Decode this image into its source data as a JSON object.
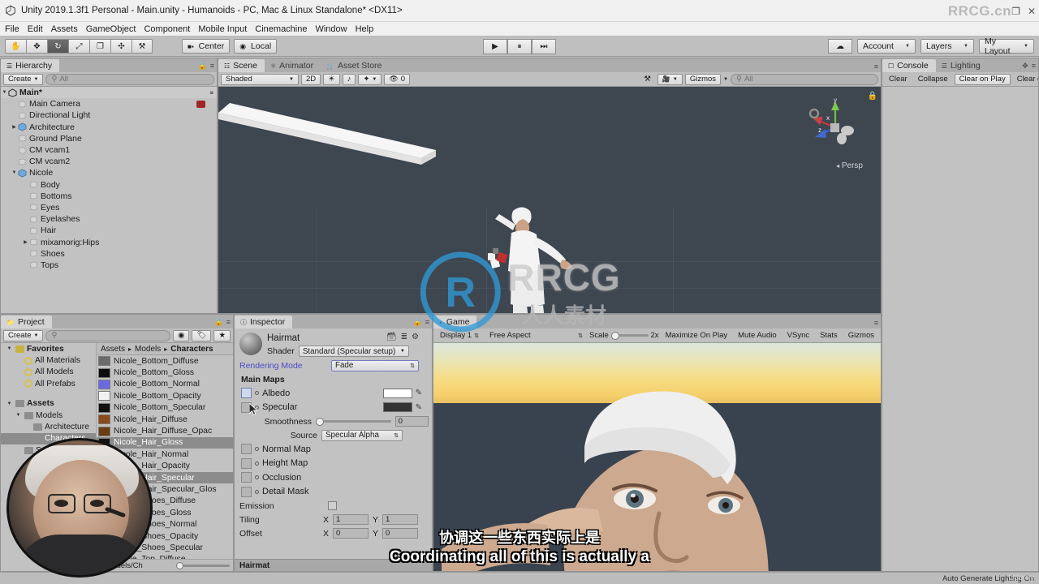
{
  "window": {
    "title": "Unity 2019.1.3f1 Personal - Main.unity - Humanoids - PC, Mac & Linux Standalone* <DX11>",
    "minimize": "–",
    "maximize": "❐",
    "close": "✕",
    "watermark": "RRCG.cn"
  },
  "menu": {
    "items": [
      "File",
      "Edit",
      "Assets",
      "GameObject",
      "Component",
      "Mobile Input",
      "Cinemachine",
      "Window",
      "Help"
    ]
  },
  "toolbar": {
    "tools": [
      {
        "name": "hand-tool",
        "glyph": "✋",
        "selected": false
      },
      {
        "name": "move-tool",
        "glyph": "✥",
        "selected": false
      },
      {
        "name": "rotate-tool",
        "glyph": "↻",
        "selected": true
      },
      {
        "name": "scale-tool",
        "glyph": "⤢",
        "selected": false
      },
      {
        "name": "rect-tool",
        "glyph": "❐",
        "selected": false
      },
      {
        "name": "transform-tool",
        "glyph": "✣",
        "selected": false
      },
      {
        "name": "custom-tool",
        "glyph": "⚒",
        "selected": false
      }
    ],
    "pivot_mode": "Center",
    "pivot_rotation": "Local",
    "play": "▶",
    "pause": "⏸",
    "step": "⏭",
    "cloud": "☁",
    "account": "Account",
    "layers": "Layers",
    "layout": "My Layout"
  },
  "hierarchy": {
    "tab": "Hierarchy",
    "create": "Create",
    "search_placeholder": "All",
    "scene_name": "Main*",
    "items": [
      {
        "label": "Main Camera",
        "depth": 1,
        "expandable": false,
        "prefab": false,
        "camera_badge": true
      },
      {
        "label": "Directional Light",
        "depth": 1,
        "expandable": false,
        "prefab": false
      },
      {
        "label": "Architecture",
        "depth": 1,
        "expandable": true,
        "expanded": false,
        "prefab": true
      },
      {
        "label": "Ground Plane",
        "depth": 1,
        "expandable": false,
        "prefab": false
      },
      {
        "label": "CM vcam1",
        "depth": 1,
        "expandable": false,
        "prefab": false
      },
      {
        "label": "CM vcam2",
        "depth": 1,
        "expandable": false,
        "prefab": false
      },
      {
        "label": "Nicole",
        "depth": 1,
        "expandable": true,
        "expanded": true,
        "prefab": true
      },
      {
        "label": "Body",
        "depth": 2,
        "expandable": false,
        "prefab": false
      },
      {
        "label": "Bottoms",
        "depth": 2,
        "expandable": false,
        "prefab": false
      },
      {
        "label": "Eyes",
        "depth": 2,
        "expandable": false,
        "prefab": false
      },
      {
        "label": "Eyelashes",
        "depth": 2,
        "expandable": false,
        "prefab": false
      },
      {
        "label": "Hair",
        "depth": 2,
        "expandable": false,
        "prefab": false
      },
      {
        "label": "mixamorig:Hips",
        "depth": 2,
        "expandable": true,
        "expanded": false,
        "prefab": false
      },
      {
        "label": "Shoes",
        "depth": 2,
        "expandable": false,
        "prefab": false
      },
      {
        "label": "Tops",
        "depth": 2,
        "expandable": false,
        "prefab": false
      }
    ]
  },
  "scene": {
    "tabs": [
      {
        "label": "Scene",
        "icon": "grid-icon",
        "selected": true
      },
      {
        "label": "Animator",
        "icon": "animator-icon",
        "selected": false
      },
      {
        "label": "Asset Store",
        "icon": "store-icon",
        "selected": false
      }
    ],
    "draw_mode": "Shaded",
    "mode_2d": "2D",
    "lighting_icon": "☀",
    "audio_icon": "♪",
    "fx_icon": "✦",
    "hidden_count": "0",
    "gizmos": "Gizmos",
    "search_placeholder": "All",
    "perspective_label": "Persp",
    "axis_x": "x",
    "axis_y": "y",
    "axis_z": "z"
  },
  "project": {
    "tab": "Project",
    "create": "Create",
    "search_placeholder": "",
    "breadcrumb": [
      "Assets",
      "Models",
      "Characters"
    ],
    "tree": [
      {
        "label": "Favorites",
        "depth": 0,
        "kind": "folder-yellow",
        "expanded": true,
        "bold": true
      },
      {
        "label": "All Materials",
        "depth": 1,
        "kind": "favorite"
      },
      {
        "label": "All Models",
        "depth": 1,
        "kind": "favorite"
      },
      {
        "label": "All Prefabs",
        "depth": 1,
        "kind": "favorite"
      },
      {
        "label": "",
        "depth": 0,
        "kind": "spacer"
      },
      {
        "label": "Assets",
        "depth": 0,
        "kind": "folder",
        "expanded": true,
        "bold": true
      },
      {
        "label": "Models",
        "depth": 1,
        "kind": "folder",
        "expanded": true
      },
      {
        "label": "Architecture",
        "depth": 2,
        "kind": "folder"
      },
      {
        "label": "Characters",
        "depth": 2,
        "kind": "folder",
        "selected": true
      },
      {
        "label": "S",
        "depth": 1,
        "kind": "folder"
      }
    ],
    "assets": [
      {
        "label": "Nicole_Bottom_Diffuse",
        "color": "#6b6b6b",
        "selected": false
      },
      {
        "label": "Nicole_Bottom_Gloss",
        "color": "#0d0d0d",
        "selected": false
      },
      {
        "label": "Nicole_Bottom_Normal",
        "color": "#6a6ae0",
        "selected": false
      },
      {
        "label": "Nicole_Bottom_Opacity",
        "color": "#f2f2f2",
        "selected": false
      },
      {
        "label": "Nicole_Bottom_Specular",
        "color": "#101010",
        "selected": false
      },
      {
        "label": "Nicole_Hair_Diffuse",
        "color": "#8a4b18",
        "selected": false
      },
      {
        "label": "Nicole_Hair_Diffuse_Opac",
        "color": "#6d3c12",
        "selected": false
      },
      {
        "label": "Nicole_Hair_Gloss",
        "color": "#121212",
        "selected": true
      },
      {
        "label": "Nicole_Hair_Normal",
        "color": "#5e5eb5",
        "selected": false
      },
      {
        "label": "Nicole_Hair_Opacity",
        "color": "#cfcfcf",
        "selected": false
      },
      {
        "label": "Nicole_Hair_Specular",
        "color": "#1a1a1a",
        "selected": true
      },
      {
        "label": "Nicole_Hair_Specular_Glos",
        "color": "#262626",
        "selected": false
      },
      {
        "label": "Nicole_Shoes_Diffuse",
        "color": "#9a9a9a",
        "selected": false
      },
      {
        "label": "Nicole_Shoes_Gloss",
        "color": "#141414",
        "selected": false
      },
      {
        "label": "Nicole_Shoes_Normal",
        "color": "#6f6fd0",
        "selected": false
      },
      {
        "label": "Nicole_Shoes_Opacity",
        "color": "#e8e8e8",
        "selected": false
      },
      {
        "label": "Nicole_Shoes_Specular",
        "color": "#1c1c1c",
        "selected": false
      },
      {
        "label": "Nicole_Top_Diffuse",
        "color": "#b5b5b5",
        "selected": false
      }
    ],
    "status_path": "s/Models/Ch"
  },
  "inspector": {
    "tab": "Inspector",
    "material_name": "Hairmat",
    "shader_label": "Shader",
    "shader_value": "Standard (Specular setup)",
    "rendering_mode_label": "Rendering Mode",
    "rendering_mode_value": "Fade",
    "main_maps_label": "Main Maps",
    "albedo_label": "Albedo",
    "albedo_color": "#ffffff",
    "specular_label": "Specular",
    "specular_color": "#333333",
    "smoothness_label": "Smoothness",
    "smoothness_value": "0",
    "source_label": "Source",
    "source_value": "Specular Alpha",
    "texture_slots": [
      "Normal Map",
      "Height Map",
      "Occlusion",
      "Detail Mask"
    ],
    "emission_label": "Emission",
    "tiling_label": "Tiling",
    "tiling_x": "1",
    "tiling_y": "1",
    "offset_label": "Offset",
    "offset_x": "0",
    "offset_y": "0",
    "axis_x": "X",
    "axis_y": "Y",
    "footer_name": "Hairmat"
  },
  "game": {
    "tab": "Game",
    "display": "Display 1",
    "aspect": "Free Aspect",
    "scale_label": "Scale",
    "scale_value": "2x",
    "maximize_on_play": "Maximize On Play",
    "mute_audio": "Mute Audio",
    "vsync": "VSync",
    "stats": "Stats",
    "gizmos": "Gizmos"
  },
  "console": {
    "tabs": [
      {
        "label": "Console",
        "selected": true
      },
      {
        "label": "Lighting",
        "selected": false
      }
    ],
    "buttons": [
      "Clear",
      "Collapse",
      "Clear on Play",
      "Clear on B"
    ]
  },
  "status": {
    "lighting": "Auto Generate Lighting On"
  },
  "overlay": {
    "watermark_text": "RRCG",
    "watermark_sub": "人人素材",
    "subtitle_cn": "协调这一些东西实际上是",
    "subtitle_en": "Coordinating all of this is actually a",
    "udemy": "Udemy"
  }
}
